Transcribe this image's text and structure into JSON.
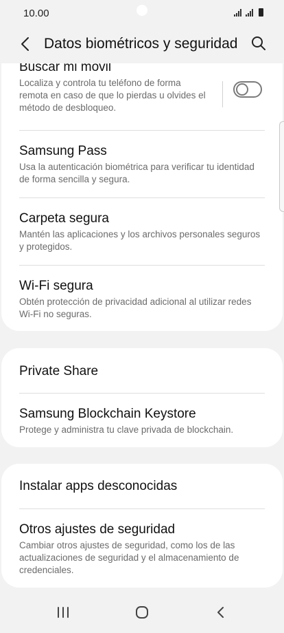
{
  "status_bar": {
    "time": "10.00"
  },
  "header": {
    "title": "Datos biométricos y seguridad"
  },
  "items": {
    "buscar_movil": {
      "title": "Buscar mi móvil",
      "desc": "Localiza y controla tu teléfono de forma remota en caso de que lo pierdas u olvides el método de desbloqueo.",
      "toggle_on": false
    },
    "samsung_pass": {
      "title": "Samsung Pass",
      "desc": "Usa la autenticación biométrica para verificar tu identidad de forma sencilla y segura."
    },
    "carpeta_segura": {
      "title": "Carpeta segura",
      "desc": "Mantén las aplicaciones y los archivos personales seguros y protegidos."
    },
    "wifi_segura": {
      "title": "Wi-Fi segura",
      "desc": "Obtén protección de privacidad adicional al utilizar redes Wi-Fi no seguras."
    },
    "private_share": {
      "title": "Private Share"
    },
    "blockchain": {
      "title": "Samsung Blockchain Keystore",
      "desc": "Protege y administra tu clave privada de blockchain."
    },
    "instalar_apps": {
      "title": "Instalar apps desconocidas"
    },
    "otros_ajustes": {
      "title": "Otros ajustes de seguridad",
      "desc": "Cambiar otros ajustes de seguridad, como los de las actualizaciones de seguridad y el almacenamiento de credenciales."
    }
  },
  "icons": {
    "back": "chevron-left-icon",
    "search": "search-icon",
    "recents": "recents-icon",
    "home": "home-icon",
    "nav_back": "nav-back-icon"
  }
}
